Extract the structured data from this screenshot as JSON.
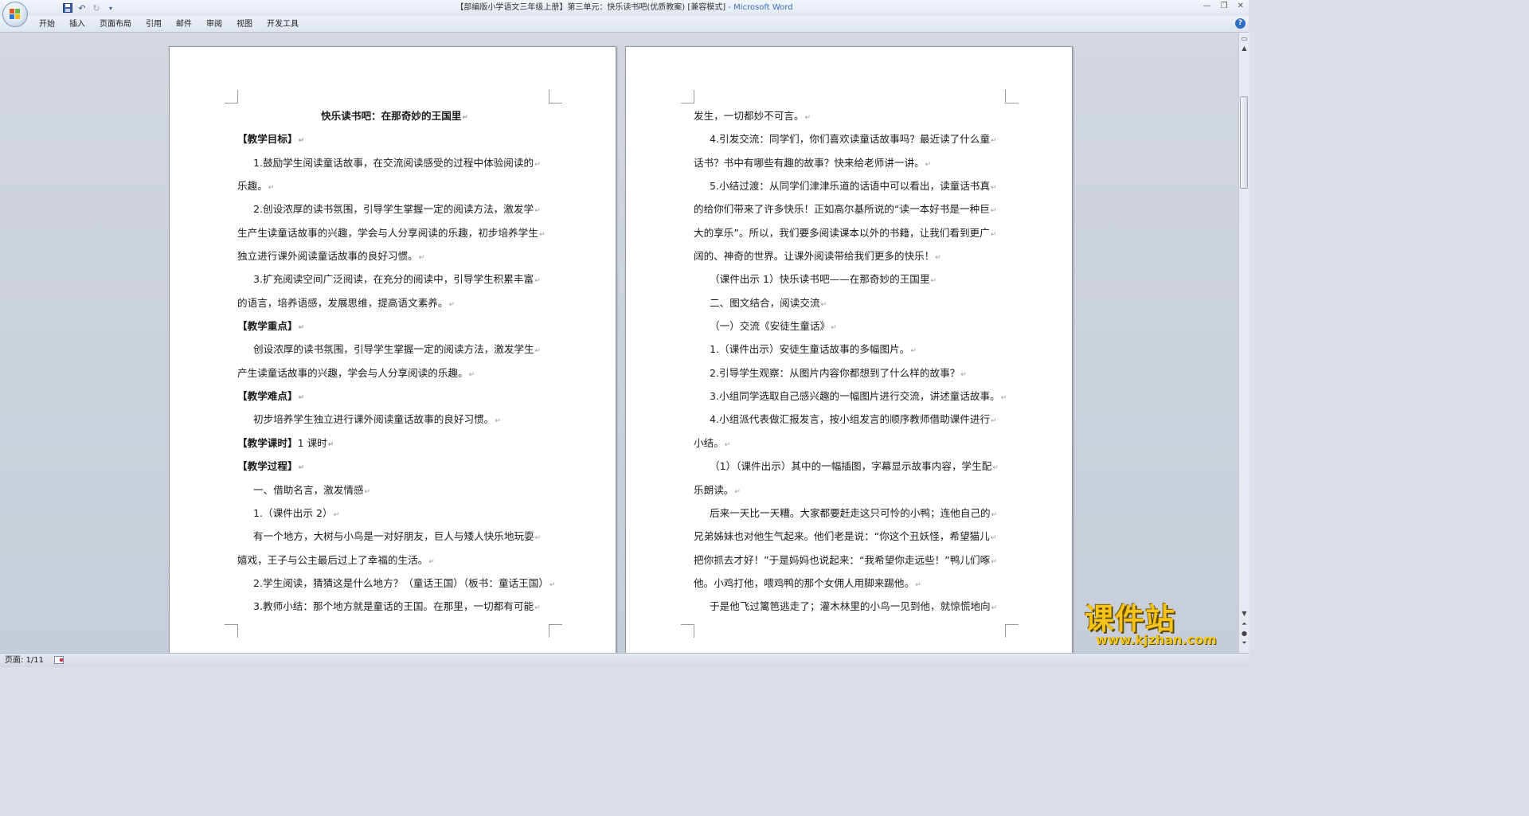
{
  "window": {
    "title": "【部编版小学语文三年级上册】第三单元：快乐读书吧(优质教案) [兼容模式]",
    "app_name": "- Microsoft Word"
  },
  "ribbon": {
    "tabs": [
      "开始",
      "插入",
      "页面布局",
      "引用",
      "邮件",
      "审阅",
      "视图",
      "开发工具"
    ]
  },
  "status": {
    "page_indicator": "页面: 1/11"
  },
  "watermark": {
    "text": "课件站",
    "url": "www.kjzhan.com"
  },
  "page1": {
    "lines": [
      {
        "text": "快乐读书吧：在那奇妙的王国里",
        "style": "center"
      },
      {
        "text": "【教学目标】",
        "style": "head"
      },
      {
        "text": "1.鼓励学生阅读童话故事，在交流阅读感受的过程中体验阅读的",
        "style": "ind"
      },
      {
        "text": "乐趣。",
        "style": "plain"
      },
      {
        "text": "2.创设浓厚的读书氛围，引导学生掌握一定的阅读方法，激发学",
        "style": "ind"
      },
      {
        "text": "生产生读童话故事的兴趣，学会与人分享阅读的乐趣，初步培养学生",
        "style": "plain"
      },
      {
        "text": "独立进行课外阅读童话故事的良好习惯。",
        "style": "plain"
      },
      {
        "text": "3.扩充阅读空间广泛阅读，在充分的阅读中，引导学生积累丰富",
        "style": "ind"
      },
      {
        "text": "的语言，培养语感，发展思维，提高语文素养。",
        "style": "plain"
      },
      {
        "text": "【教学重点】",
        "style": "head"
      },
      {
        "text": "创设浓厚的读书氛围，引导学生掌握一定的阅读方法，激发学生",
        "style": "ind"
      },
      {
        "text": "产生读童话故事的兴趣，学会与人分享阅读的乐趣。",
        "style": "plain"
      },
      {
        "text": "【教学难点】",
        "style": "head"
      },
      {
        "text": "初步培养学生独立进行课外阅读童话故事的良好习惯。",
        "style": "ind"
      },
      {
        "text": "【教学课时】",
        "rest": "1 课时",
        "style": "head"
      },
      {
        "text": "【教学过程】",
        "style": "head"
      },
      {
        "text": "一、借助名言，激发情感",
        "style": "ind"
      },
      {
        "text": "1.（课件出示 2）",
        "style": "ind"
      },
      {
        "text": "有一个地方，大树与小鸟是一对好朋友，巨人与矮人快乐地玩耍",
        "style": "ind"
      },
      {
        "text": "嬉戏，王子与公主最后过上了幸福的生活。",
        "style": "plain"
      },
      {
        "text": "2.学生阅读，猜猜这是什么地方？（童话王国）（板书：童话王国）",
        "style": "ind"
      },
      {
        "text": "3.教师小结：那个地方就是童话的王国。在那里，一切都有可能",
        "style": "ind"
      }
    ]
  },
  "page2": {
    "lines": [
      {
        "text": "发生，一切都妙不可言。",
        "style": "plain"
      },
      {
        "text": "4.引发交流：同学们，你们喜欢读童话故事吗？最近读了什么童",
        "style": "ind"
      },
      {
        "text": "话书？书中有哪些有趣的故事？快来给老师讲一讲。",
        "style": "plain"
      },
      {
        "text": "5.小结过渡：从同学们津津乐道的话语中可以看出，读童话书真",
        "style": "ind"
      },
      {
        "text": "的给你们带来了许多快乐！正如高尔基所说的“读一本好书是一种巨",
        "style": "plain"
      },
      {
        "text": "大的享乐”。所以，我们要多阅读课本以外的书籍，让我们看到更广",
        "style": "plain"
      },
      {
        "text": "阔的、神奇的世界。让课外阅读带给我们更多的快乐！",
        "style": "plain"
      },
      {
        "text": "（课件出示 1）快乐读书吧——在那奇妙的王国里",
        "style": "ind"
      },
      {
        "text": "二、图文结合，阅读交流",
        "style": "ind"
      },
      {
        "text": "（一）交流《安徒生童话》",
        "style": "ind"
      },
      {
        "text": "1.（课件出示）安徒生童话故事的多幅图片。",
        "style": "ind"
      },
      {
        "text": "2.引导学生观察：从图片内容你都想到了什么样的故事？",
        "style": "ind"
      },
      {
        "text": "3.小组同学选取自己感兴趣的一幅图片进行交流，讲述童话故事。",
        "style": "ind"
      },
      {
        "text": "4.小组派代表做汇报发言，按小组发言的顺序教师借助课件进行",
        "style": "ind"
      },
      {
        "text": "小结。",
        "style": "plain"
      },
      {
        "text": "（1）（课件出示）其中的一幅插图，字幕显示故事内容，学生配",
        "style": "ind"
      },
      {
        "text": "乐朗读。",
        "style": "plain"
      },
      {
        "text": "后来一天比一天糟。大家都要赶走这只可怜的小鸭；连他自己的",
        "style": "ind"
      },
      {
        "text": "兄弟姊妹也对他生气起来。他们老是说：“你这个丑妖怪，希望猫儿",
        "style": "plain"
      },
      {
        "text": "把你抓去才好！”于是妈妈也说起来：“我希望你走远些！”鸭儿们啄",
        "style": "plain"
      },
      {
        "text": "他。小鸡打他，喂鸡鸭的那个女佣人用脚来踢他。",
        "style": "plain"
      },
      {
        "text": "于是他飞过篱笆逃走了；灌木林里的小鸟一见到他，就惊慌地向",
        "style": "ind"
      }
    ]
  }
}
